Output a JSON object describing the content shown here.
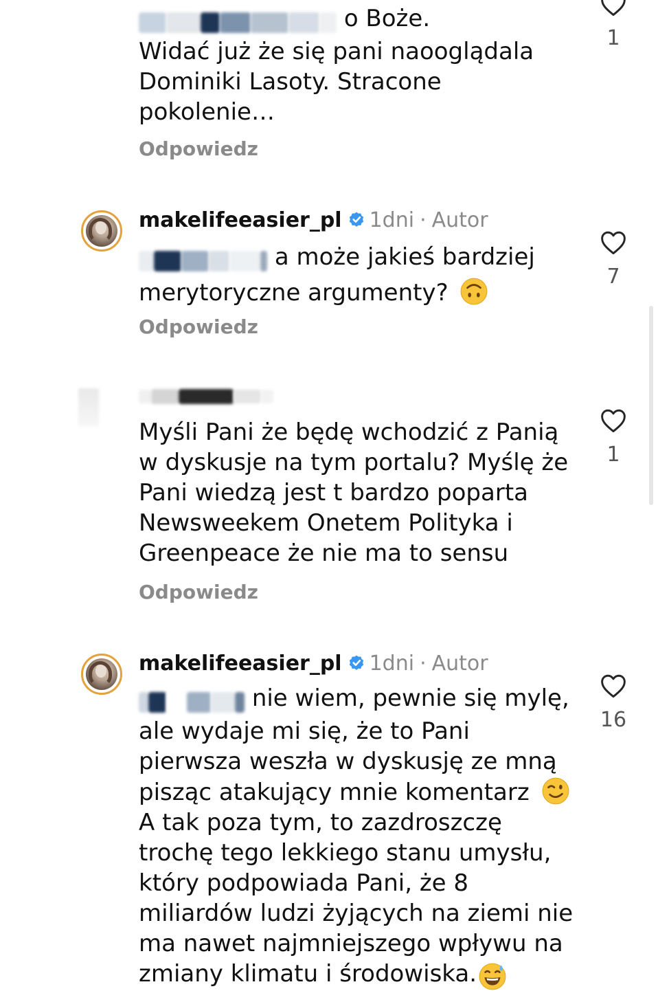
{
  "comments": [
    {
      "text_start": "o Boże.",
      "text_rest": "Widać już że się pani naooglądala Dominiki Lasoty. Stracone pokolenie…",
      "reply_label": "Odpowiedz",
      "likes": "1"
    },
    {
      "username": "makelifeeasier_pl",
      "time": "1dni",
      "separator": "·",
      "role": "Autor",
      "text": "a może jakieś bardziej merytoryczne argumenty?",
      "emoji": "upside-down-face",
      "reply_label": "Odpowiedz",
      "likes": "7"
    },
    {
      "text": "Myśli Pani że będę wchodzić z Panią w dyskusje na tym portalu? Myślę że Pani wiedzą jest t bardzo poparta Newsweekem Onetem Polityka i Greenpeace że nie ma to sensu",
      "reply_label": "Odpowiedz",
      "likes": "1"
    },
    {
      "username": "makelifeeasier_pl",
      "time": "1dni",
      "separator": "·",
      "role": "Autor",
      "text_part1": "nie wiem, pewnie się mylę, ale wydaje mi się, że to Pani pierwsza weszła w dyskusję ze mną pisząc atakujący mnie komentarz",
      "emoji1": "winking-face",
      "text_part2": "A tak poza tym, to zazdroszczę trochę tego lekkiego stanu umysłu, który podpowiada Pani, że 8 miliardów ludzi żyjących na ziemi nie ma nawet najmniejszego wpływu na zmiany klimatu i środowiska.",
      "emoji2": "grinning-face-with-sweat",
      "likes": "16"
    }
  ],
  "colors": {
    "verified": "#3897f0",
    "muted": "#8a8a8a",
    "story_ring": "#e3a23c"
  }
}
